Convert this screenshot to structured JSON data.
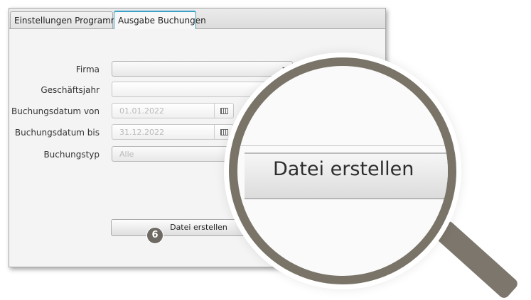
{
  "tabs": [
    {
      "label": "Einstellungen Programm",
      "active": false
    },
    {
      "label": "Ausgabe Buchungen",
      "active": true
    }
  ],
  "form": {
    "firma": {
      "label": "Firma",
      "value": ""
    },
    "geschaeftsjahr": {
      "label": "Geschäftsjahr",
      "value": ""
    },
    "buchungsdatum_von": {
      "label": "Buchungsdatum von",
      "value": "01.01.2022"
    },
    "buchungsdatum_bis": {
      "label": "Buchungsdatum bis",
      "value": "31.12.2022"
    },
    "buchungstyp": {
      "label": "Buchungstyp",
      "value": "Alle"
    }
  },
  "actions": {
    "create_file_label": "Datei erstellen"
  },
  "step_badge": "6",
  "magnifier": {
    "label": "Datei erstellen"
  },
  "colors": {
    "accent": "#3aa0c8",
    "magnifier_frame": "#7a7468",
    "badge": "#6e6a63"
  },
  "icons": [
    "caret-down-icon",
    "calendar-icon",
    "magnifier-icon"
  ]
}
